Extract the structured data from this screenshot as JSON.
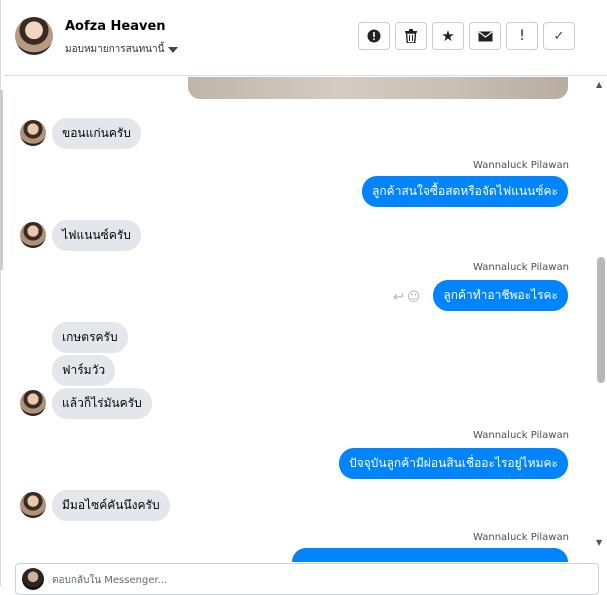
{
  "header": {
    "name": "Aofza Heaven",
    "subtitle": "มอบหมายการสนทนานี้",
    "tools": [
      {
        "icon": "alert-circle-icon",
        "glyph": "!"
      },
      {
        "icon": "trash-icon"
      },
      {
        "icon": "star-icon",
        "glyph": "★"
      },
      {
        "icon": "envelope-icon"
      },
      {
        "icon": "exclamation-icon",
        "glyph": "!"
      },
      {
        "icon": "check-icon",
        "glyph": "✓"
      }
    ]
  },
  "messages": {
    "m1": "ขอนแก่นครับ",
    "s1": "Wannaluck Pilawan",
    "o1": "ลูกค้าสนใจซื้อสดหรือจัดไฟแนนซ์คะ",
    "m2": "ไฟแนนซ์ครับ",
    "s2": "Wannaluck Pilawan",
    "o2": "ลูกค้าทำอาชีพอะไรคะ",
    "m3": "เกษตรครับ",
    "m4": "ฟาร์มวัว",
    "m5": "แล้วก็ไร่มันครับ",
    "s3": "Wannaluck Pilawan",
    "o3": "ปัจจุบันลูกค้ามีผ่อนสินเชื่ออะไรอยู่ไหมคะ",
    "m6": "มีมอไซค์คันนึงครับ",
    "s4": "Wannaluck Pilawan"
  },
  "composer": {
    "placeholder": "ตอบกลับใน Messenger..."
  }
}
